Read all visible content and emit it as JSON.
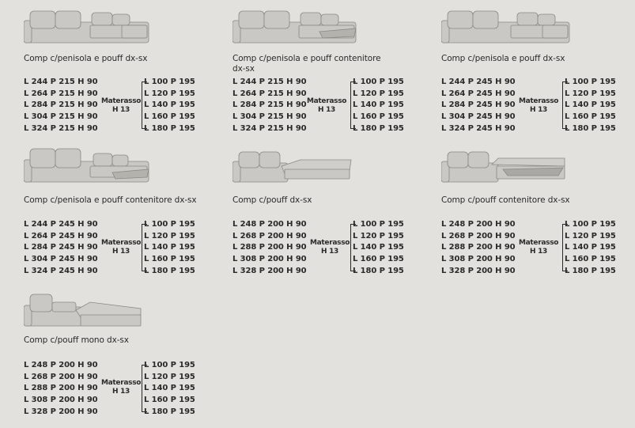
{
  "colors": {
    "background": "#e2e1dd",
    "sofa_fill": "#c9c8c4",
    "sofa_stroke": "#8a8985",
    "text": "#2a2a2a"
  },
  "mattress_label": "Materasso",
  "mattress_height": "H 13",
  "mattress_sizes": [
    "L 100 P 195",
    "L 120 P 195",
    "L 140 P 195",
    "L 160 P 195",
    "L 180 P 195"
  ],
  "items": [
    {
      "title": "Comp c/penisola e pouff dx-sx",
      "dims": [
        "L 244 P 215 H 90",
        "L 264 P 215 H 90",
        "L 284 P 215 H 90",
        "L 304 P 215 H 90",
        "L 324 P 215 H 90"
      ]
    },
    {
      "title": "Comp c/penisola e pouff contenitore dx-sx",
      "dims": [
        "L 244 P 215 H 90",
        "L 264 P 215 H 90",
        "L 284 P 215 H 90",
        "L 304 P 215 H 90",
        "L 324 P 215 H 90"
      ]
    },
    {
      "title": "Comp c/penisola e pouff dx-sx",
      "dims": [
        "L 244 P 245 H 90",
        "L 264 P 245 H 90",
        "L 284 P 245 H 90",
        "L 304 P 245 H 90",
        "L 324 P 245 H 90"
      ]
    },
    {
      "title": "Comp c/penisola e pouff contenitore dx-sx",
      "dims": [
        "L 244 P 245 H 90",
        "L 264 P 245 H 90",
        "L 284 P 245 H 90",
        "L 304 P 245 H 90",
        "L 324 P 245 H 90"
      ]
    },
    {
      "title": "Comp c/pouff dx-sx",
      "dims": [
        "L 248 P 200 H 90",
        "L 268 P 200 H 90",
        "L 288 P 200 H 90",
        "L 308 P 200 H 90",
        "L 328 P 200 H 90"
      ]
    },
    {
      "title": "Comp c/pouff contenitore dx-sx",
      "dims": [
        "L 248 P 200 H 90",
        "L 268 P 200 H 90",
        "L 288 P 200 H 90",
        "L 308 P 200 H 90",
        "L 328 P 200 H 90"
      ]
    },
    {
      "title": "Comp c/pouff mono dx-sx",
      "dims": [
        "L 248 P 200 H 90",
        "L 268 P 200 H 90",
        "L 288 P 200 H 90",
        "L 308 P 200 H 90",
        "L 328 P 200 H 90"
      ]
    }
  ]
}
